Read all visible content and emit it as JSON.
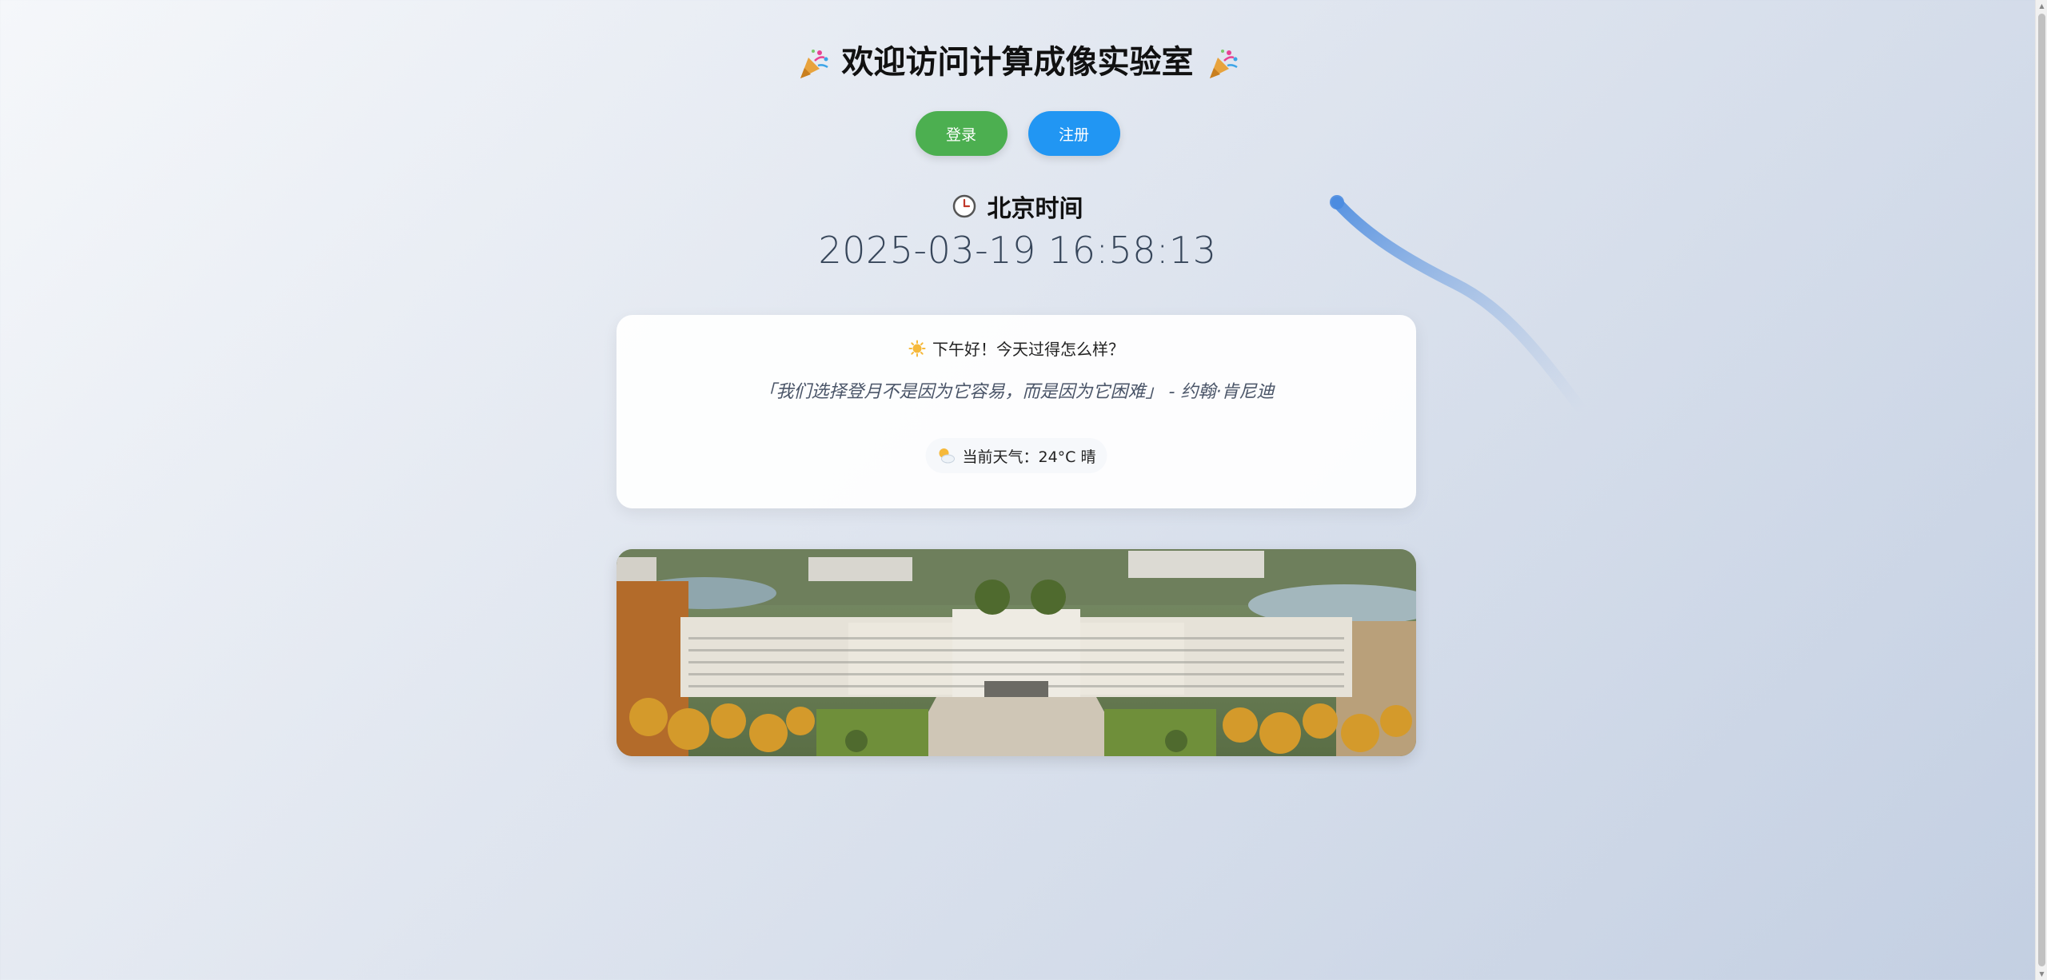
{
  "header": {
    "title": "欢迎访问计算成像实验室",
    "left_icon": "party-popper-icon",
    "right_icon": "party-popper-icon"
  },
  "auth": {
    "login_label": "登录",
    "register_label": "注册",
    "login_color": "#4caf50",
    "register_color": "#2196f3"
  },
  "clock": {
    "icon": "clock-icon",
    "heading": "北京时间",
    "datetime": "2025-03-19 16:58:13"
  },
  "card": {
    "greeting_icon": "sun-icon",
    "greeting": "下午好！今天过得怎么样？",
    "quote": "「我们选择登月不是因为它容易，而是因为它困难」 - 约翰·肯尼迪",
    "weather_icon": "sun-behind-cloud-icon",
    "weather": "当前天气：24°C 晴"
  },
  "banner": {
    "image": "campus-aerial-photo"
  }
}
